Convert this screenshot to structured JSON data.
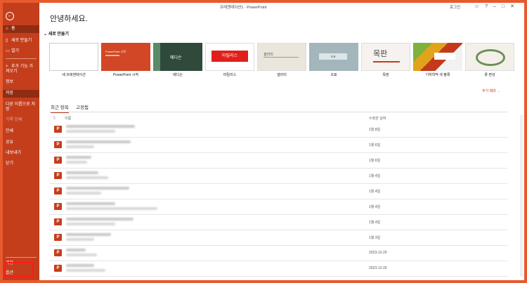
{
  "window": {
    "title": "프레젠테이션1  -  PowerPoint",
    "user": "로그인"
  },
  "greeting": "안녕하세요.",
  "sidebar": {
    "items": [
      {
        "label": "홈"
      },
      {
        "label": "새로 만들기"
      },
      {
        "label": "열기"
      },
      {
        "label": "추가 기능 가져오기"
      },
      {
        "label": "정보"
      },
      {
        "label": "저장"
      },
      {
        "label": "다른 이름으로 저장"
      },
      {
        "label": "기록 인쇄"
      },
      {
        "label": "인쇄"
      },
      {
        "label": "공유"
      },
      {
        "label": "내보내기"
      },
      {
        "label": "닫기"
      },
      {
        "label": "계정"
      },
      {
        "label": "옵션"
      }
    ]
  },
  "new_section": {
    "heading": "새로 만들기",
    "templates": [
      {
        "label": "새 프레젠테이션",
        "thumb": ""
      },
      {
        "label": "PowerPoint 시작",
        "thumb": "PowerPoint 시작"
      },
      {
        "label": "메디슨",
        "thumb": "메디슨"
      },
      {
        "label": "마틸리스",
        "thumb": "마틸리스"
      },
      {
        "label": "갤러리",
        "thumb": "갤러리"
      },
      {
        "label": "조표",
        "thumb": "조표"
      },
      {
        "label": "목판",
        "thumb": "목판"
      },
      {
        "label": "기하학적 색 블록",
        "thumb": ""
      },
      {
        "label": "꽃 편성",
        "thumb": ""
      }
    ],
    "more": "추가 테마 →"
  },
  "tabs": [
    {
      "label": "최근 항목"
    },
    {
      "label": "고정됨"
    }
  ],
  "columns": {
    "name": "이름",
    "date": "수정한 날짜"
  },
  "files": [
    {
      "date": "1월 8일"
    },
    {
      "date": "1월 6일"
    },
    {
      "date": "1월 6일"
    },
    {
      "date": "1월 4일"
    },
    {
      "date": "1월 4일"
    },
    {
      "date": "1월 4일"
    },
    {
      "date": "1월 4일"
    },
    {
      "date": "1월 3일"
    },
    {
      "date": "2023-12-29"
    },
    {
      "date": "2023-12-29"
    }
  ]
}
